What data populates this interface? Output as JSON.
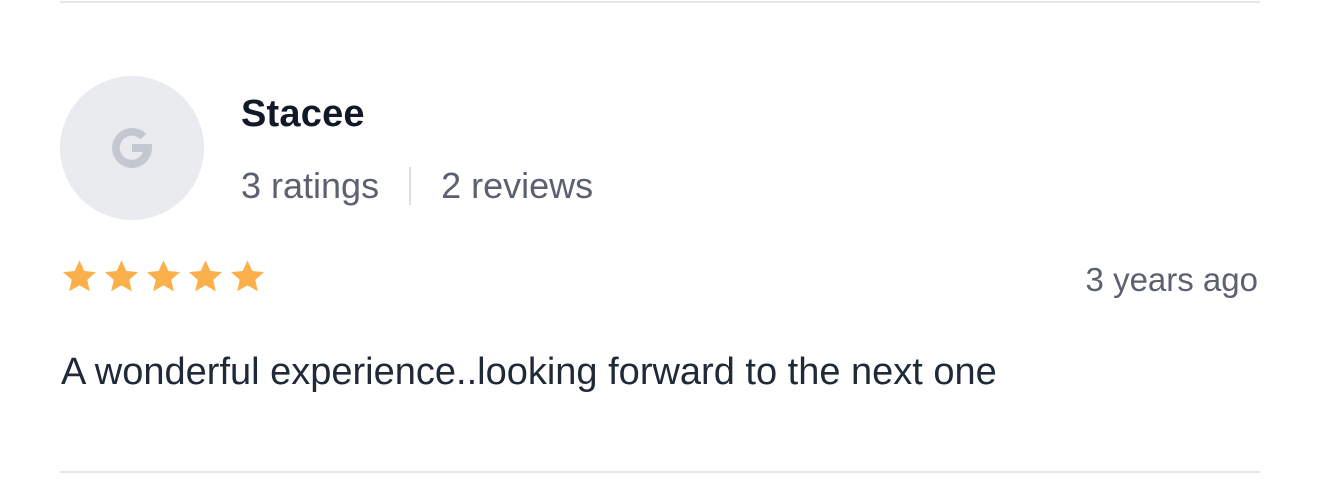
{
  "review": {
    "avatar_initial": "G",
    "reviewer_name": "Stacee",
    "ratings_count": "3 ratings",
    "reviews_count": "2 reviews",
    "rating": 5,
    "rating_max": 5,
    "timestamp": "3 years ago",
    "text": "A wonderful experience..looking forward to the next one"
  },
  "colors": {
    "star": "#fbb04b",
    "avatar_bg": "#eaebef",
    "avatar_glyph": "#c3c7d0",
    "divider": "#e6e7ea"
  },
  "icons": {
    "avatar": "google-g-icon",
    "star": "star-icon"
  }
}
